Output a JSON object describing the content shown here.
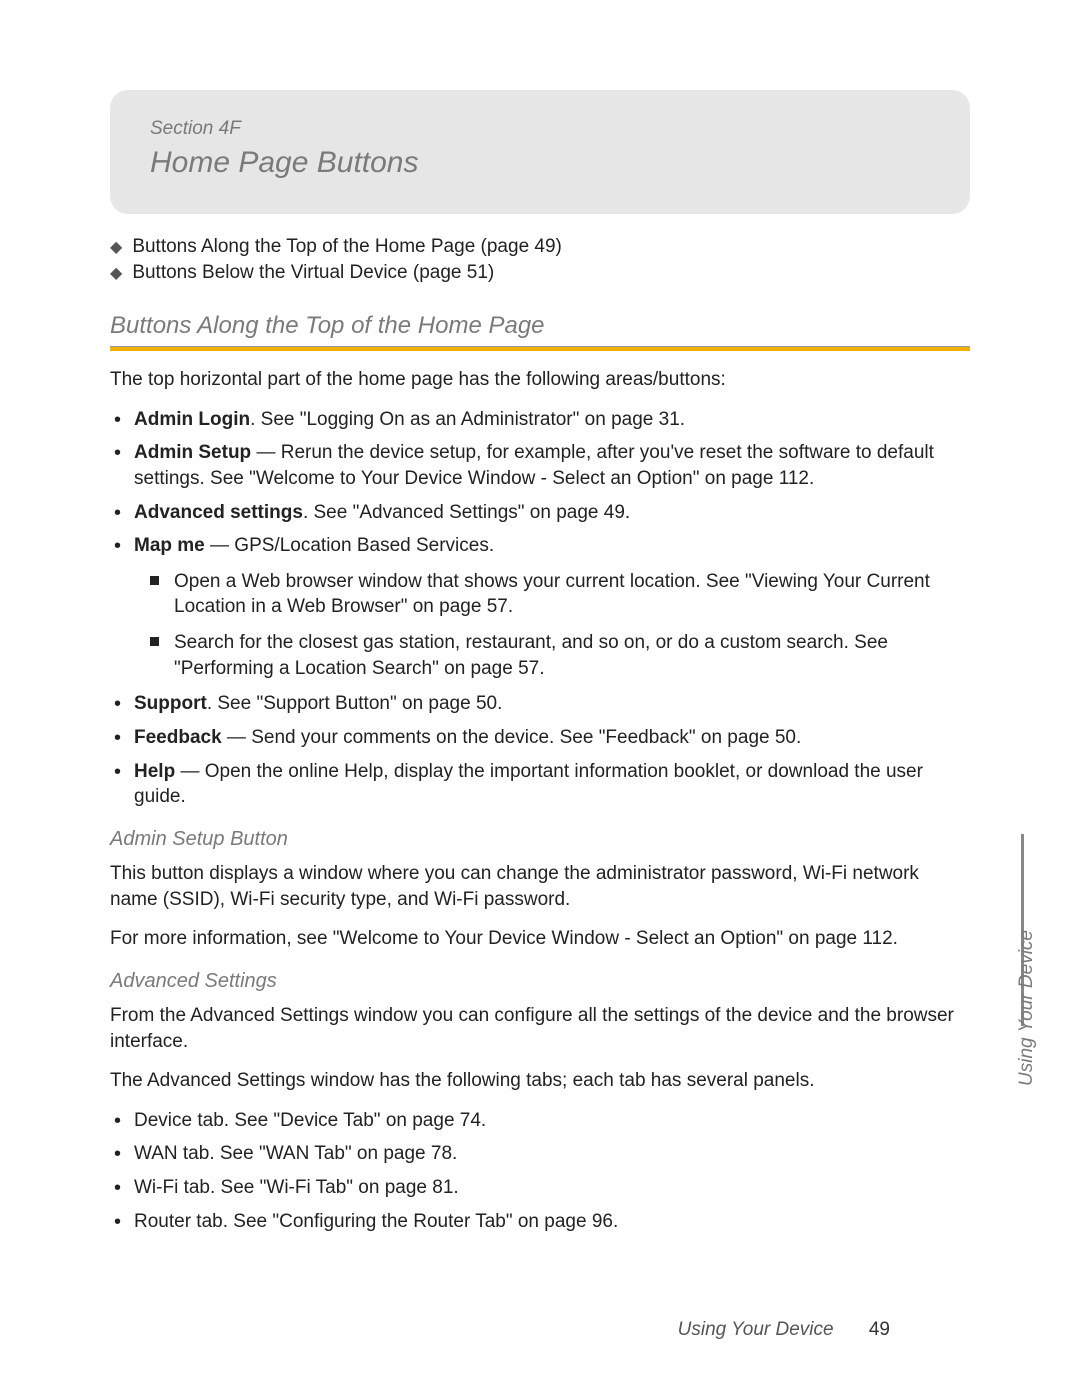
{
  "header": {
    "section_label": "Section 4F",
    "title": "Home Page Buttons"
  },
  "toc": [
    "Buttons Along the Top of the Home Page (page 49)",
    "Buttons Below the Virtual Device (page 51)"
  ],
  "h2": "Buttons Along the Top of the Home Page",
  "intro": "The top horizontal part of the home page has the following areas/buttons:",
  "items": [
    {
      "term": "Admin Login",
      "rest": ". See \"Logging On as an Administrator\" on page 31."
    },
    {
      "term": "Admin Setup",
      "rest": " — Rerun the device setup, for example, after you've reset the software to default settings. See \"Welcome to Your Device Window - Select an Option\" on page 112."
    },
    {
      "term": "Advanced settings",
      "rest": ". See \"Advanced Settings\" on page 49."
    },
    {
      "term": "Map me",
      "rest": " — GPS/Location Based Services.",
      "sub": [
        "Open a Web browser window that shows your current location. See \"Viewing Your Current Location in a Web Browser\" on page 57.",
        "Search for the closest gas station, restaurant, and so on, or do a custom search. See \"Performing a Location Search\" on page 57."
      ]
    },
    {
      "term": "Support",
      "rest": ". See \"Support Button\" on page 50."
    },
    {
      "term": "Feedback",
      "rest": " — Send your comments on the device. See \"Feedback\" on page 50."
    },
    {
      "term": "Help",
      "rest": " — Open the online Help, display the important information booklet, or download the user guide."
    }
  ],
  "admin_setup": {
    "heading": "Admin Setup Button",
    "p1": "This button displays a window where you can change the administrator password, Wi-Fi network name (SSID), Wi-Fi security type, and Wi-Fi password.",
    "p2": "For more information, see \"Welcome to Your Device Window - Select an Option\" on page 112."
  },
  "adv": {
    "heading": "Advanced Settings",
    "p1": "From the Advanced Settings window you can configure all the settings of the device and the browser interface.",
    "p2": "The Advanced Settings window has the following tabs; each tab has several panels.",
    "tabs": [
      "Device tab. See \"Device Tab\" on page 74.",
      "WAN tab. See \"WAN Tab\" on page 78.",
      "Wi-Fi tab. See \"Wi-Fi Tab\" on page 81.",
      "Router tab. See \"Configuring the Router Tab\" on page 96."
    ]
  },
  "side_tab": "Using Your Device",
  "footer": {
    "text": "Using Your Device",
    "page": "49"
  }
}
